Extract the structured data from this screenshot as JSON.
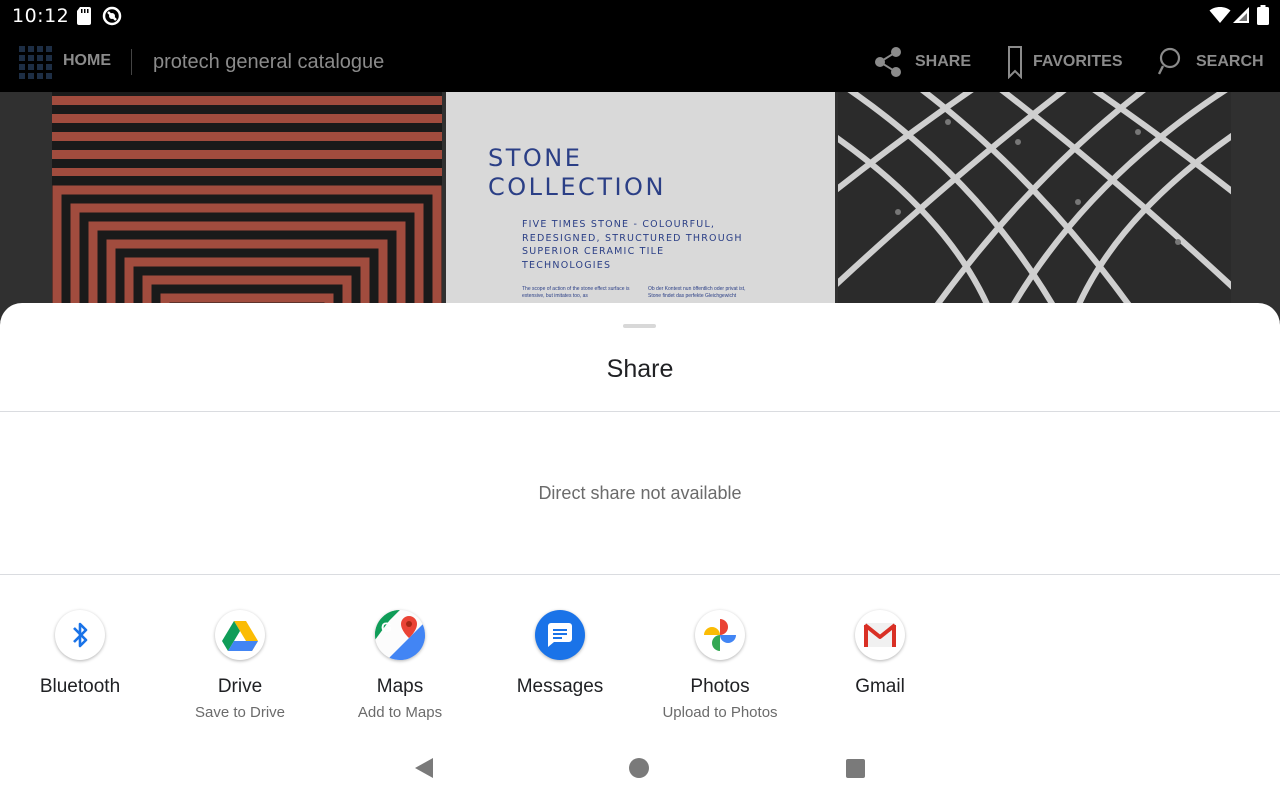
{
  "status_bar": {
    "time": "10:12"
  },
  "app_bar": {
    "home_label": "HOME",
    "document_title": "protech general catalogue",
    "share_label": "SHARE",
    "favorites_label": "FAVORITES",
    "search_label": "SEARCH"
  },
  "preview": {
    "title_line1": "STONE",
    "title_line2": "COLLECTION",
    "subtitle": "FIVE TIMES STONE - COLOURFUL, REDESIGNED, STRUCTURED THROUGH SUPERIOR CERAMIC TILE TECHNOLOGIES",
    "body_left": "The scope of action of the stone effect surface is extensive, but imitates too, as",
    "body_right": "Ob der Kontext nun öffentlich oder privat ist, Stone findet das perfekte Gleichgewicht"
  },
  "share_sheet": {
    "title": "Share",
    "direct_share_message": "Direct share not available",
    "targets": [
      {
        "label": "Bluetooth",
        "sublabel": "",
        "icon": "bluetooth-icon"
      },
      {
        "label": "Drive",
        "sublabel": "Save to Drive",
        "icon": "google-drive-icon"
      },
      {
        "label": "Maps",
        "sublabel": "Add to Maps",
        "icon": "google-maps-icon"
      },
      {
        "label": "Messages",
        "sublabel": "",
        "icon": "messages-icon"
      },
      {
        "label": "Photos",
        "sublabel": "Upload to Photos",
        "icon": "google-photos-icon"
      },
      {
        "label": "Gmail",
        "sublabel": "",
        "icon": "gmail-icon"
      }
    ]
  },
  "colors": {
    "accent_blue": "#1a73e8",
    "stone_title_blue": "#2b3f86",
    "stripe_red": "#a14c3e",
    "toolbar_text": "#8b8b8b"
  }
}
